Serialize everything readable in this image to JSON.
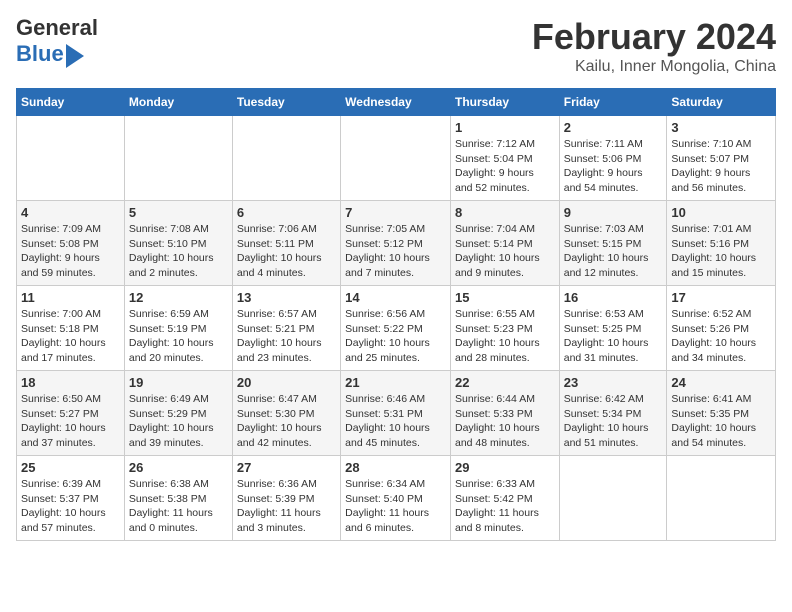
{
  "header": {
    "logo_line1": "General",
    "logo_line2": "Blue",
    "title": "February 2024",
    "subtitle": "Kailu, Inner Mongolia, China"
  },
  "calendar": {
    "days_of_week": [
      "Sunday",
      "Monday",
      "Tuesday",
      "Wednesday",
      "Thursday",
      "Friday",
      "Saturday"
    ],
    "weeks": [
      [
        {
          "day": "",
          "info": ""
        },
        {
          "day": "",
          "info": ""
        },
        {
          "day": "",
          "info": ""
        },
        {
          "day": "",
          "info": ""
        },
        {
          "day": "1",
          "info": "Sunrise: 7:12 AM\nSunset: 5:04 PM\nDaylight: 9 hours\nand 52 minutes."
        },
        {
          "day": "2",
          "info": "Sunrise: 7:11 AM\nSunset: 5:06 PM\nDaylight: 9 hours\nand 54 minutes."
        },
        {
          "day": "3",
          "info": "Sunrise: 7:10 AM\nSunset: 5:07 PM\nDaylight: 9 hours\nand 56 minutes."
        }
      ],
      [
        {
          "day": "4",
          "info": "Sunrise: 7:09 AM\nSunset: 5:08 PM\nDaylight: 9 hours\nand 59 minutes."
        },
        {
          "day": "5",
          "info": "Sunrise: 7:08 AM\nSunset: 5:10 PM\nDaylight: 10 hours\nand 2 minutes."
        },
        {
          "day": "6",
          "info": "Sunrise: 7:06 AM\nSunset: 5:11 PM\nDaylight: 10 hours\nand 4 minutes."
        },
        {
          "day": "7",
          "info": "Sunrise: 7:05 AM\nSunset: 5:12 PM\nDaylight: 10 hours\nand 7 minutes."
        },
        {
          "day": "8",
          "info": "Sunrise: 7:04 AM\nSunset: 5:14 PM\nDaylight: 10 hours\nand 9 minutes."
        },
        {
          "day": "9",
          "info": "Sunrise: 7:03 AM\nSunset: 5:15 PM\nDaylight: 10 hours\nand 12 minutes."
        },
        {
          "day": "10",
          "info": "Sunrise: 7:01 AM\nSunset: 5:16 PM\nDaylight: 10 hours\nand 15 minutes."
        }
      ],
      [
        {
          "day": "11",
          "info": "Sunrise: 7:00 AM\nSunset: 5:18 PM\nDaylight: 10 hours\nand 17 minutes."
        },
        {
          "day": "12",
          "info": "Sunrise: 6:59 AM\nSunset: 5:19 PM\nDaylight: 10 hours\nand 20 minutes."
        },
        {
          "day": "13",
          "info": "Sunrise: 6:57 AM\nSunset: 5:21 PM\nDaylight: 10 hours\nand 23 minutes."
        },
        {
          "day": "14",
          "info": "Sunrise: 6:56 AM\nSunset: 5:22 PM\nDaylight: 10 hours\nand 25 minutes."
        },
        {
          "day": "15",
          "info": "Sunrise: 6:55 AM\nSunset: 5:23 PM\nDaylight: 10 hours\nand 28 minutes."
        },
        {
          "day": "16",
          "info": "Sunrise: 6:53 AM\nSunset: 5:25 PM\nDaylight: 10 hours\nand 31 minutes."
        },
        {
          "day": "17",
          "info": "Sunrise: 6:52 AM\nSunset: 5:26 PM\nDaylight: 10 hours\nand 34 minutes."
        }
      ],
      [
        {
          "day": "18",
          "info": "Sunrise: 6:50 AM\nSunset: 5:27 PM\nDaylight: 10 hours\nand 37 minutes."
        },
        {
          "day": "19",
          "info": "Sunrise: 6:49 AM\nSunset: 5:29 PM\nDaylight: 10 hours\nand 39 minutes."
        },
        {
          "day": "20",
          "info": "Sunrise: 6:47 AM\nSunset: 5:30 PM\nDaylight: 10 hours\nand 42 minutes."
        },
        {
          "day": "21",
          "info": "Sunrise: 6:46 AM\nSunset: 5:31 PM\nDaylight: 10 hours\nand 45 minutes."
        },
        {
          "day": "22",
          "info": "Sunrise: 6:44 AM\nSunset: 5:33 PM\nDaylight: 10 hours\nand 48 minutes."
        },
        {
          "day": "23",
          "info": "Sunrise: 6:42 AM\nSunset: 5:34 PM\nDaylight: 10 hours\nand 51 minutes."
        },
        {
          "day": "24",
          "info": "Sunrise: 6:41 AM\nSunset: 5:35 PM\nDaylight: 10 hours\nand 54 minutes."
        }
      ],
      [
        {
          "day": "25",
          "info": "Sunrise: 6:39 AM\nSunset: 5:37 PM\nDaylight: 10 hours\nand 57 minutes."
        },
        {
          "day": "26",
          "info": "Sunrise: 6:38 AM\nSunset: 5:38 PM\nDaylight: 11 hours\nand 0 minutes."
        },
        {
          "day": "27",
          "info": "Sunrise: 6:36 AM\nSunset: 5:39 PM\nDaylight: 11 hours\nand 3 minutes."
        },
        {
          "day": "28",
          "info": "Sunrise: 6:34 AM\nSunset: 5:40 PM\nDaylight: 11 hours\nand 6 minutes."
        },
        {
          "day": "29",
          "info": "Sunrise: 6:33 AM\nSunset: 5:42 PM\nDaylight: 11 hours\nand 8 minutes."
        },
        {
          "day": "",
          "info": ""
        },
        {
          "day": "",
          "info": ""
        }
      ]
    ]
  }
}
